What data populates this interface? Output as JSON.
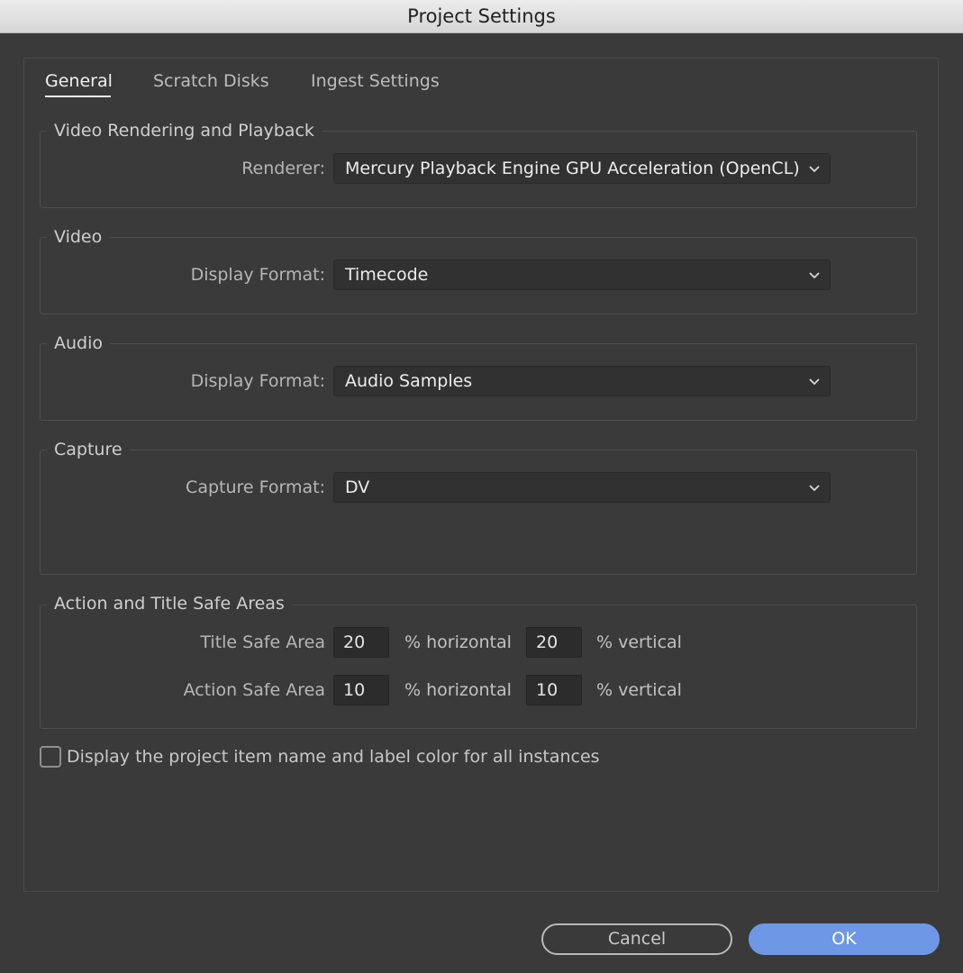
{
  "window": {
    "title": "Project Settings"
  },
  "tabs": [
    {
      "label": "General",
      "active": true
    },
    {
      "label": "Scratch Disks",
      "active": false
    },
    {
      "label": "Ingest Settings",
      "active": false
    }
  ],
  "video_rendering": {
    "legend": "Video Rendering and Playback",
    "renderer_label": "Renderer:",
    "renderer_value": "Mercury Playback Engine GPU Acceleration (OpenCL)"
  },
  "video": {
    "legend": "Video",
    "display_format_label": "Display Format:",
    "display_format_value": "Timecode"
  },
  "audio": {
    "legend": "Audio",
    "display_format_label": "Display Format:",
    "display_format_value": "Audio Samples"
  },
  "capture": {
    "legend": "Capture",
    "capture_format_label": "Capture Format:",
    "capture_format_value": "DV"
  },
  "safe_areas": {
    "legend": "Action and Title Safe Areas",
    "title_safe_label": "Title Safe Area",
    "title_safe_horizontal": "20",
    "title_safe_vertical": "20",
    "action_safe_label": "Action Safe Area",
    "action_safe_horizontal": "10",
    "action_safe_vertical": "10",
    "horizontal_unit": "% horizontal",
    "vertical_unit": "% vertical"
  },
  "display_item_name": {
    "label": "Display the project item name and label color for all instances",
    "checked": false
  },
  "buttons": {
    "cancel": "Cancel",
    "ok": "OK"
  },
  "colors": {
    "background": "#3a3a3a",
    "ok_button": "#6e98e6",
    "titlebar": "#e0e0e0"
  },
  "icons": {
    "dropdown": "chevron-down-icon"
  }
}
